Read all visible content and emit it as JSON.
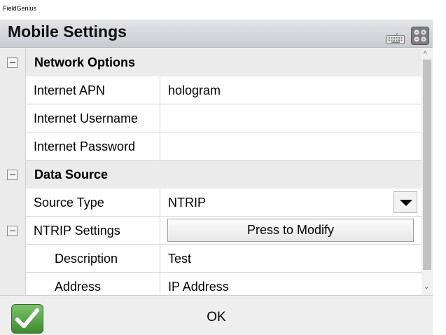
{
  "app": {
    "title": "FieldGenius"
  },
  "header": {
    "title": "Mobile Settings"
  },
  "sections": {
    "network": {
      "label": "Network Options",
      "rows": [
        {
          "name": "Internet APN",
          "value": "hologram"
        },
        {
          "name": "Internet Username",
          "value": ""
        },
        {
          "name": "Internet Password",
          "value": ""
        }
      ]
    },
    "data_source": {
      "label": "Data Source",
      "source_type": {
        "name": "Source Type",
        "value": "NTRIP"
      },
      "ntrip": {
        "name": "NTRIP Settings",
        "button_label": "Press to Modify",
        "rows": [
          {
            "name": "Description",
            "value": "Test"
          },
          {
            "name": "Address",
            "value": "IP Address"
          }
        ]
      }
    }
  },
  "footer": {
    "ok_label": "OK"
  },
  "icons": {
    "keyboard": "keyboard-icon",
    "keypad": "keypad-icon",
    "ok_check": "checkmark-icon",
    "collapse": "collapse-icon",
    "dropdown": "dropdown-arrow-icon"
  }
}
